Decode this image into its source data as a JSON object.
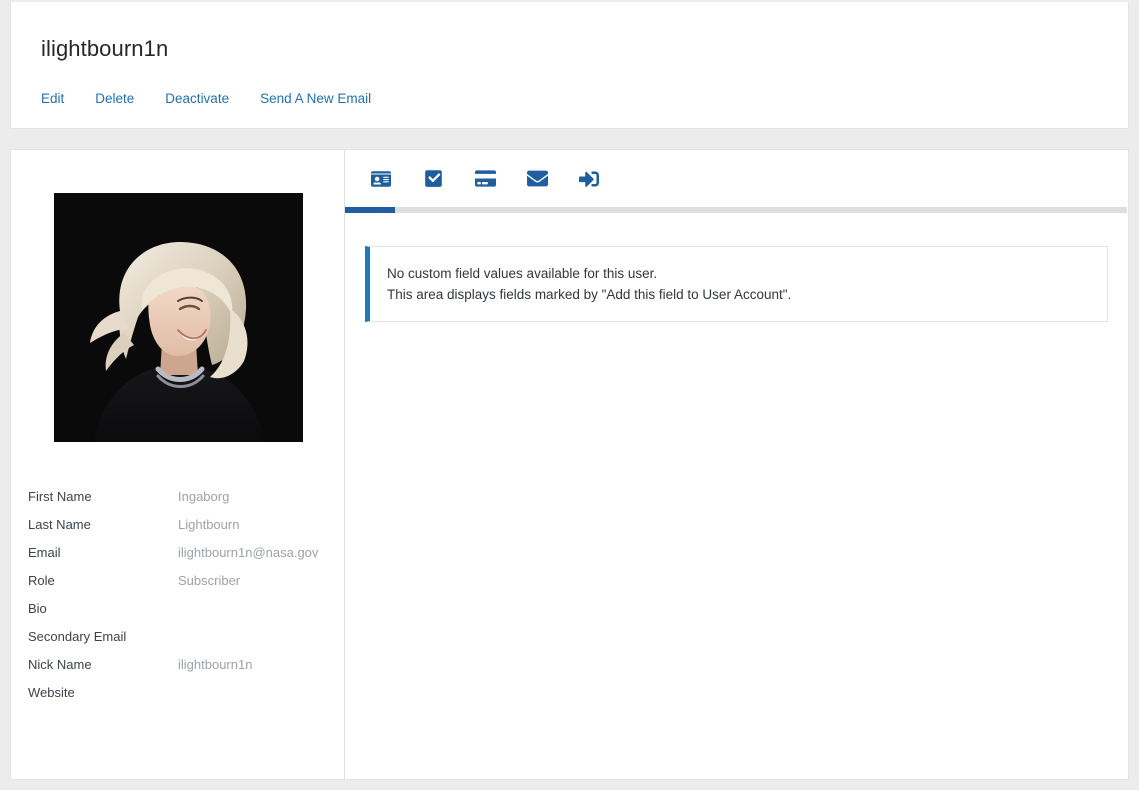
{
  "header": {
    "title": "ilightbourn1n",
    "actions": [
      {
        "label": "Edit",
        "name": "edit-link"
      },
      {
        "label": "Delete",
        "name": "delete-link"
      },
      {
        "label": "Deactivate",
        "name": "deactivate-link"
      },
      {
        "label": "Send A New Email",
        "name": "send-new-email-link"
      }
    ]
  },
  "profile": {
    "avatar_alt": "user-avatar-photo",
    "fields": [
      {
        "label": "First Name",
        "value": "Ingaborg"
      },
      {
        "label": "Last Name",
        "value": "Lightbourn"
      },
      {
        "label": "Email",
        "value": "ilightbourn1n@nasa.gov"
      },
      {
        "label": "Role",
        "value": "Subscriber"
      },
      {
        "label": "Bio",
        "value": ""
      },
      {
        "label": "Secondary Email",
        "value": ""
      },
      {
        "label": "Nick Name",
        "value": "ilightbourn1n"
      },
      {
        "label": "Website",
        "value": ""
      }
    ]
  },
  "tabs": [
    {
      "icon": "id-card-icon",
      "name": "tab-profile",
      "active": true
    },
    {
      "icon": "check-square-icon",
      "name": "tab-approval",
      "active": false
    },
    {
      "icon": "credit-card-icon",
      "name": "tab-billing",
      "active": false
    },
    {
      "icon": "envelope-icon",
      "name": "tab-emails",
      "active": false
    },
    {
      "icon": "sign-in-icon",
      "name": "tab-logins",
      "active": false
    }
  ],
  "notice": {
    "line1": "No custom field values available for this user.",
    "line2": "This area displays fields marked by \"Add this field to User Account\"."
  },
  "colors": {
    "link": "#2271b1",
    "icon_blue": "#1f5fa0",
    "notice_accent": "#1a7bb9",
    "page_background": "#ececec",
    "value_text": "#9da3a8"
  }
}
